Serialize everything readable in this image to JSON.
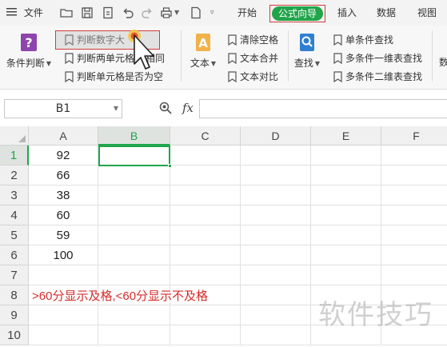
{
  "menubar": {
    "menu_label": "文件",
    "tabs": [
      "开始",
      "公式向导",
      "插入",
      "数据",
      "视图"
    ],
    "active_tab": "公式向导"
  },
  "ribbon": {
    "condition_button": "条件判断",
    "text_button": "文本",
    "lookup_button": "查找",
    "condition_items": [
      "判断数字大",
      "判断两单元格",
      "相同",
      "判断单元格是否为空"
    ],
    "text_items": [
      "清除空格",
      "文本合并",
      "文本对比"
    ],
    "lookup_items": [
      "单条件查找",
      "多条件一维表查找",
      "多条件二维表查找"
    ],
    "more_label": "数"
  },
  "formula_bar": {
    "name_box": "B1",
    "fx_label": "fx",
    "formula": ""
  },
  "sheet": {
    "columns": [
      "A",
      "B",
      "C",
      "D",
      "E",
      "F"
    ],
    "rows": [
      "1",
      "2",
      "3",
      "4",
      "5",
      "6",
      "7",
      "8",
      "9",
      "10"
    ],
    "active_cell": "B1",
    "column_a_values": [
      "92",
      "66",
      "38",
      "60",
      "59",
      "100"
    ],
    "note": ">60分显示及格,<60分显示不及格"
  },
  "watermark": "软件技巧",
  "colors": {
    "accent": "#21a54b",
    "highlight_border": "#d23b3b",
    "note_text": "#d62b2b"
  }
}
